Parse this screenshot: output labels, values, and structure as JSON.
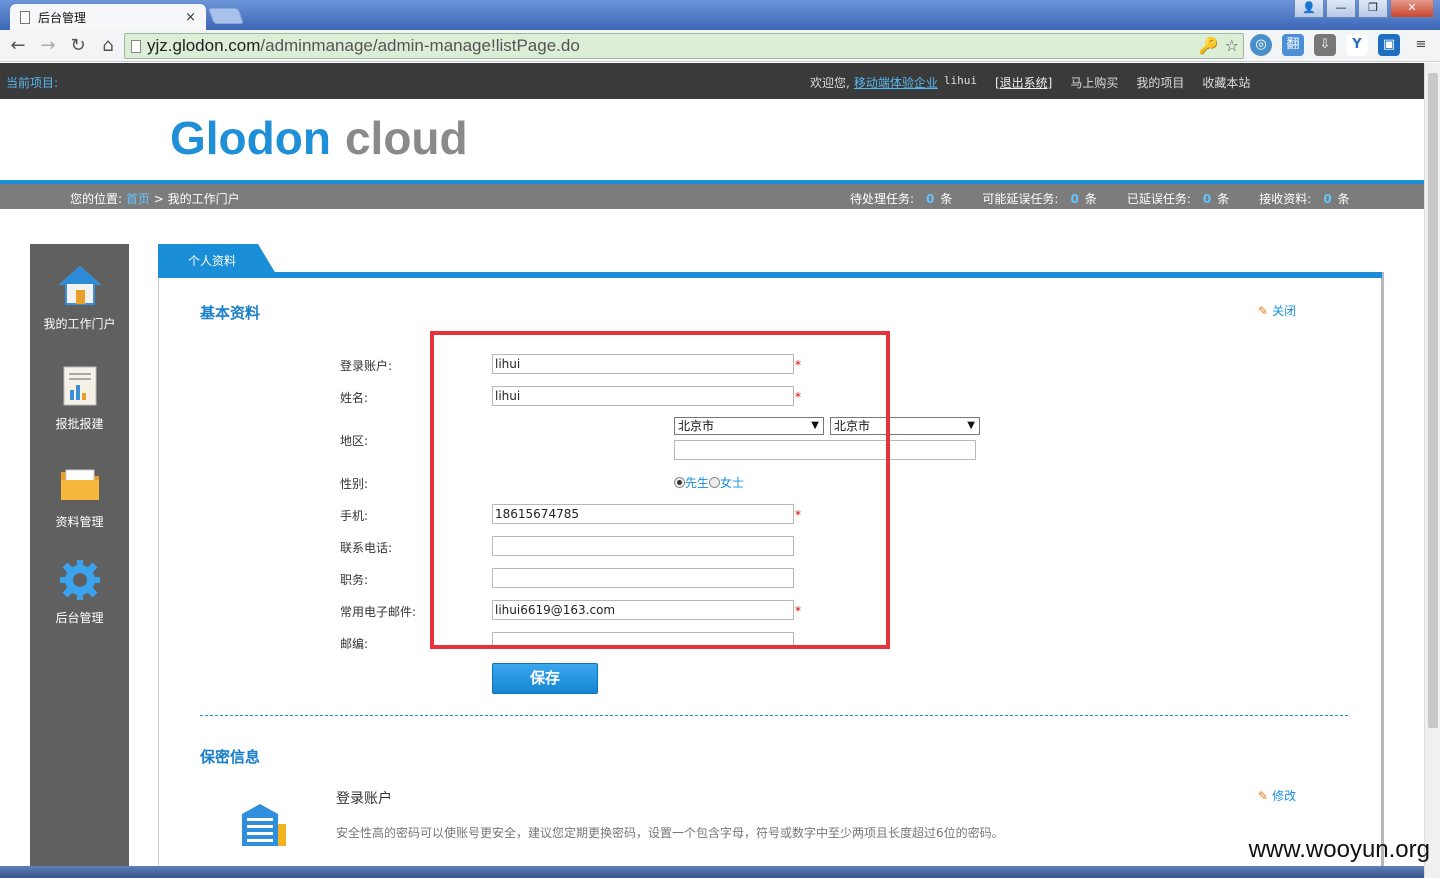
{
  "browser": {
    "tab_title": "后台管理",
    "tab_close": "×",
    "url_host": "yjz.glodon.com",
    "url_path": "/adminmanage/admin-manage!listPage.do",
    "window_buttons": [
      "—",
      "❐",
      "✕"
    ]
  },
  "topbar": {
    "project_label": "当前项目:",
    "welcome": "欢迎您,",
    "company": "移动端体验企业",
    "username": "lihui",
    "logout": "[退出系统]",
    "buy": "马上购买",
    "my_projects": "我的项目",
    "bookmark": "收藏本站"
  },
  "logo": {
    "part1": "Glodon",
    "part2": "cloud"
  },
  "breadcrumb": {
    "prefix": "您的位置:",
    "home": "首页",
    "sep": " > ",
    "current": "我的工作门户"
  },
  "stats": [
    {
      "label": "待处理任务:",
      "value": "0",
      "unit": "条"
    },
    {
      "label": "可能延误任务:",
      "value": "0",
      "unit": "条"
    },
    {
      "label": "已延误任务:",
      "value": "0",
      "unit": "条"
    },
    {
      "label": "接收资料:",
      "value": "0",
      "unit": "条"
    }
  ],
  "sidebar": {
    "items": [
      {
        "label": "我的工作门户",
        "icon": "house-icon"
      },
      {
        "label": "报批报建",
        "icon": "report-icon"
      },
      {
        "label": "资料管理",
        "icon": "folder-icon"
      },
      {
        "label": "后台管理",
        "icon": "gear-icon"
      }
    ]
  },
  "panel": {
    "tab_label": "个人资料",
    "basic_title": "基本资料",
    "close_label": "关闭",
    "form": {
      "account_label": "登录账户:",
      "account_value": "lihui",
      "name_label": "姓名:",
      "name_value": "lihui",
      "region_label": "地区:",
      "province": "北京市",
      "city": "北京市",
      "address_value": "",
      "gender_label": "性别:",
      "gender_male": "先生",
      "gender_female": "女士",
      "mobile_label": "手机:",
      "mobile_value": "18615674785",
      "phone_label": "联系电话:",
      "phone_value": "",
      "position_label": "职务:",
      "position_value": "",
      "email_label": "常用电子邮件:",
      "email_value": "lihui6619@163.com",
      "zip_label": "邮编:",
      "zip_value": "",
      "required_mark": "*"
    },
    "save_label": "保存",
    "security_title": "保密信息",
    "security_account_title": "登录账户",
    "security_edit": "修改",
    "security_desc": "安全性高的密码可以使账号更安全，建议您定期更换密码，设置一个包含字母，符号或数字中至少两项且长度超过6位的密码。"
  },
  "watermark": "www.wooyun.org",
  "colors": {
    "accent": "#1a8fd8",
    "highlight_box": "#e8323a",
    "sidebar_bg": "#606060",
    "topbar_bg": "#3a3a3a"
  }
}
